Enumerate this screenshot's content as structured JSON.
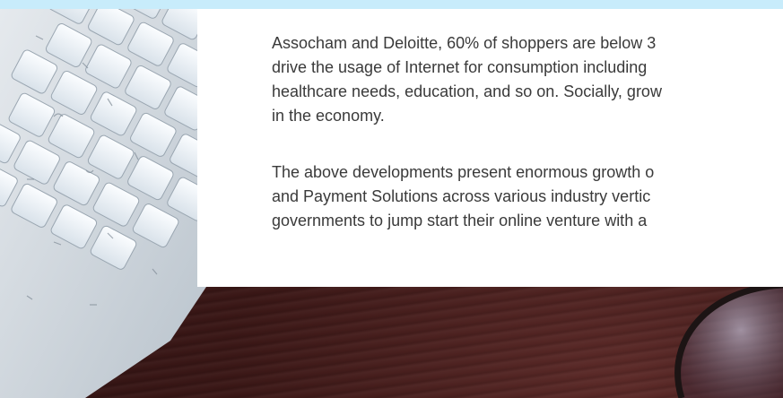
{
  "paragraphs": [
    {
      "lines": [
        "Assocham and Deloitte, 60% of shoppers are below 3",
        "drive the usage of Internet for consumption including",
        "healthcare needs, education, and so on. Socially, grow",
        "in the economy."
      ]
    },
    {
      "lines": [
        "The above developments present enormous growth o",
        "and Payment Solutions across various industry vertic",
        "governments to jump start their online venture with a"
      ]
    }
  ],
  "colors": {
    "top_band": "#c8ecfb",
    "panel": "#ffffff",
    "text": "#3a3a3a",
    "wood": "#3b1a16"
  },
  "decor": {
    "background_image": "keyboard-on-wooden-desk",
    "icons": [
      "keyboard-icon",
      "eyeglasses-icon"
    ]
  }
}
